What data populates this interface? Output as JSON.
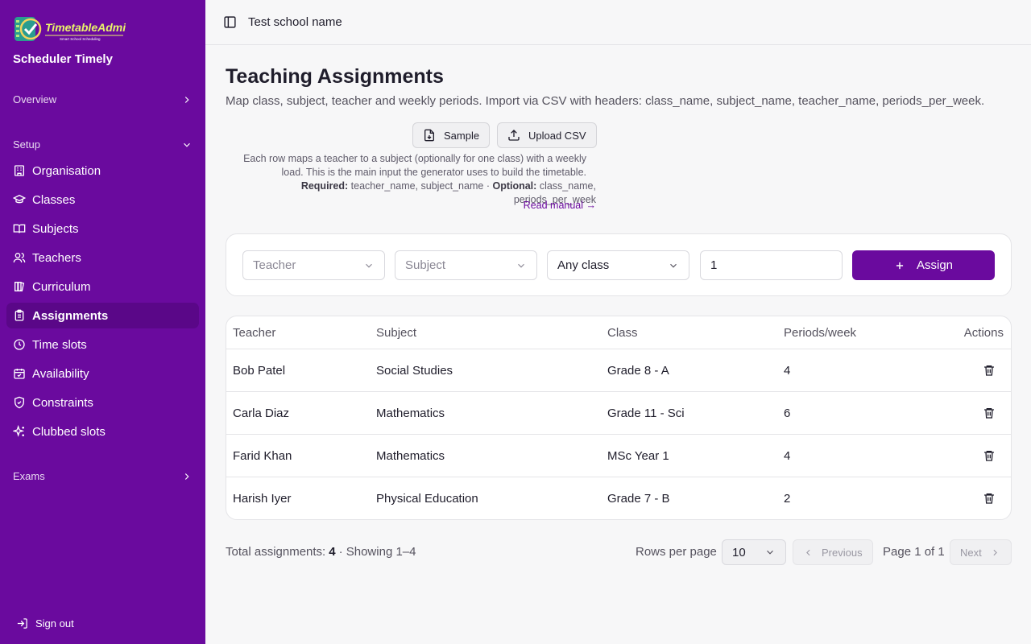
{
  "sidebar": {
    "logo_text": "TimetableAdmin",
    "logo_tagline": "Smart School Scheduling",
    "app_name": "Scheduler Timely",
    "groups": {
      "overview": "Overview",
      "setup": "Setup",
      "exams": "Exams"
    },
    "items": [
      {
        "label": "Organisation",
        "icon": "building-icon"
      },
      {
        "label": "Classes",
        "icon": "graduation-cap-icon"
      },
      {
        "label": "Subjects",
        "icon": "book-open-icon"
      },
      {
        "label": "Teachers",
        "icon": "users-icon"
      },
      {
        "label": "Curriculum",
        "icon": "library-icon"
      },
      {
        "label": "Assignments",
        "icon": "clipboard-list-icon",
        "active": true
      },
      {
        "label": "Time slots",
        "icon": "clock-icon"
      },
      {
        "label": "Availability",
        "icon": "calendar-check-icon"
      },
      {
        "label": "Constraints",
        "icon": "shield-check-icon"
      },
      {
        "label": "Clubbed slots",
        "icon": "sparkles-icon"
      }
    ],
    "sign_out": "Sign out"
  },
  "topbar": {
    "school_name": "Test school name"
  },
  "page": {
    "title": "Teaching Assignments",
    "subtitle": "Map class, subject, teacher and weekly periods. Import via CSV with headers: class_name, subject_name, teacher_name, periods_per_week.",
    "sample_button": "Sample",
    "upload_button": "Upload CSV",
    "help_line": "Each row maps a teacher to a subject (optionally for one class) with a weekly load. This is the main input the generator uses to build the timetable.",
    "required_label": "Required:",
    "required_fields": "teacher_name, subject_name",
    "separator": "·",
    "optional_label": "Optional:",
    "optional_fields": "class_name, periods_per_week",
    "read_manual": "Read manual →"
  },
  "form": {
    "teacher_placeholder": "Teacher",
    "subject_placeholder": "Subject",
    "class_value": "Any class",
    "periods_value": "1",
    "assign_button": "Assign"
  },
  "table": {
    "columns": [
      "Teacher",
      "Subject",
      "Class",
      "Periods/week",
      "Actions"
    ],
    "rows": [
      {
        "teacher": "Bob Patel",
        "subject": "Social Studies",
        "class": "Grade 8 - A",
        "periods": "4"
      },
      {
        "teacher": "Carla Diaz",
        "subject": "Mathematics",
        "class": "Grade 11 - Sci",
        "periods": "6"
      },
      {
        "teacher": "Farid Khan",
        "subject": "Mathematics",
        "class": "MSc Year 1",
        "periods": "4"
      },
      {
        "teacher": "Harish Iyer",
        "subject": "Physical Education",
        "class": "Grade 7 - B",
        "periods": "2"
      }
    ]
  },
  "footer": {
    "total_label": "Total assignments:",
    "total_value": "4",
    "showing": "· Showing 1–4",
    "rows_per_page_label": "Rows per page",
    "rows_per_page_value": "10",
    "previous": "Previous",
    "page_info": "Page 1 of 1",
    "next": "Next"
  },
  "colors": {
    "brand": "#6a0a9e",
    "brand_active": "#5a0788"
  }
}
